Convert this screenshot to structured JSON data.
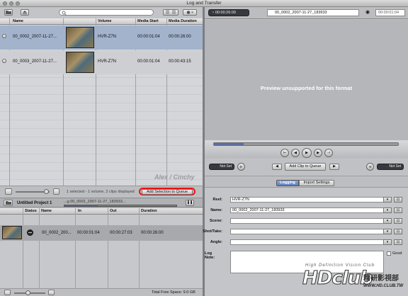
{
  "window": {
    "title": "Log and Transfer"
  },
  "browser": {
    "search_placeholder": "",
    "columns": [
      "Name",
      "Volume",
      "Media Start",
      "Media Duration"
    ],
    "clips": [
      {
        "name": "00_0002_2007-11-27...",
        "volume": "HVR-Z7N",
        "media_start": "00:00:01:04",
        "media_duration": "00:00:26:00"
      },
      {
        "name": "00_0003_2007-11-27...",
        "volume": "HVR-Z7N",
        "media_start": "00:00:01:04",
        "media_duration": "00:00:43:15"
      }
    ],
    "status": "1 selected - 1 volume, 2 clips displayed",
    "add_selection_label": "Add Selection to Queue",
    "watermark": "Alex / Cinchy"
  },
  "queue": {
    "project": "Untitled Project 1",
    "progress_text": "...g 00_0002_2007-11-27_183933...",
    "columns": [
      "Status",
      "Name",
      "In",
      "Out",
      "Duration"
    ],
    "rows": [
      {
        "name": "00_0002_200...",
        "in": "00:00:01:04",
        "out": "00:00:27:03",
        "duration": "00:00:26:00"
      }
    ],
    "free_space": "Total Free Space: 9.0 GB"
  },
  "viewer": {
    "duration": "00:00:26:00",
    "clip_name": "00_0002_2007-11-27_183933",
    "timecode": "00:00:01:04",
    "preview_message": "Preview unsupported for this format",
    "in_not_set": "Not Set",
    "out_not_set": "Not Set",
    "add_clip_label": "Add Clip to Queue"
  },
  "logging": {
    "tabs": [
      "Logging",
      "Import Settings"
    ],
    "fields": {
      "reel_label": "Reel:",
      "reel_value": "HVR-Z7N",
      "name_label": "Name:",
      "name_value": "00_0002_2007-11-27_183933",
      "scene_label": "Scene:",
      "shot_label": "Shot/Take:",
      "angle_label": "Angle:",
      "lognote_label": "Log Note:",
      "good_label": "Good"
    }
  },
  "branding": {
    "tagline": "High Definition Vision Club",
    "logo": "HDclub",
    "url": "WWW.HD.CLUB.TW",
    "chinese": "精研影視部"
  }
}
